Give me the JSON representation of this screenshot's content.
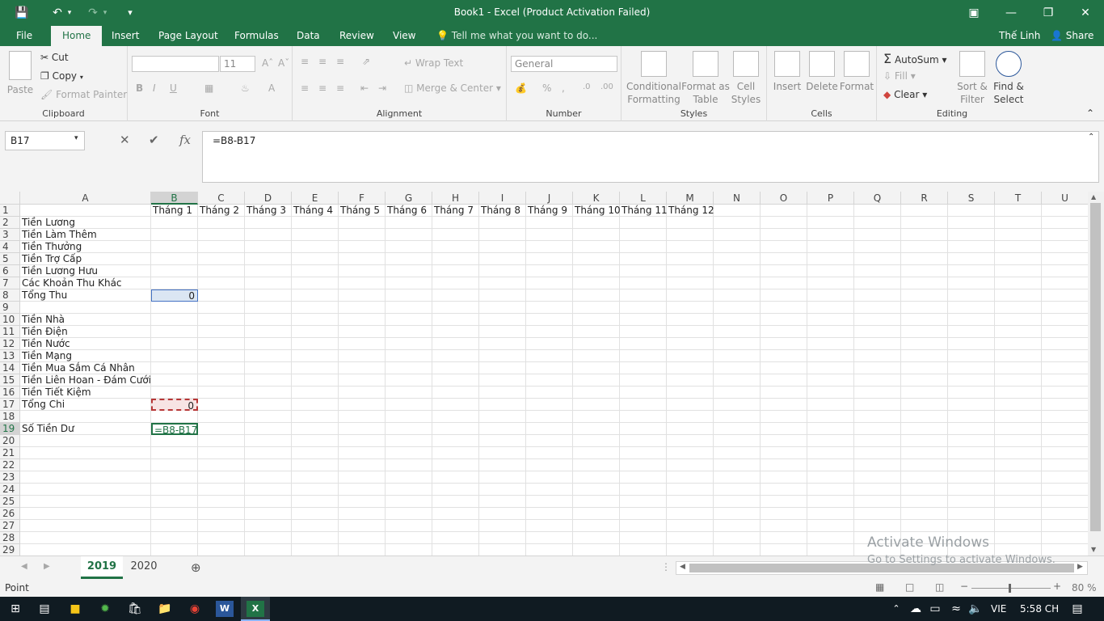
{
  "window": {
    "title": "Book1 - Excel (Product Activation Failed)",
    "user": "Thế Linh",
    "share": "Share"
  },
  "tabs": [
    "File",
    "Home",
    "Insert",
    "Page Layout",
    "Formulas",
    "Data",
    "Review",
    "View"
  ],
  "tellme": "Tell me what you want to do...",
  "ribbon": {
    "clipboard": {
      "paste": "Paste",
      "cut": "Cut",
      "copy": "Copy",
      "format_painter": "Format Painter",
      "label": "Clipboard"
    },
    "font": {
      "size": "11",
      "bold": "B",
      "italic": "I",
      "underline": "U",
      "label": "Font"
    },
    "alignment": {
      "wrap": "Wrap Text",
      "merge": "Merge & Center",
      "label": "Alignment"
    },
    "number": {
      "format": "General",
      "percent": "%",
      "comma": ",",
      "label": "Number"
    },
    "styles": {
      "conditional": "Conditional Formatting",
      "format_table": "Format as Table",
      "cell_styles": "Cell Styles",
      "label": "Styles"
    },
    "cells": {
      "insert": "Insert",
      "delete": "Delete",
      "format": "Format",
      "label": "Cells"
    },
    "editing": {
      "autosum": "AutoSum",
      "fill": "Fill",
      "clear": "Clear",
      "sort": "Sort & Filter",
      "find": "Find & Select",
      "label": "Editing"
    }
  },
  "formula_bar": {
    "name_box": "B17",
    "formula": "=B8-B17"
  },
  "columns": [
    "A",
    "B",
    "C",
    "D",
    "E",
    "F",
    "G",
    "H",
    "I",
    "J",
    "K",
    "L",
    "M",
    "N",
    "O",
    "P",
    "Q",
    "R",
    "S",
    "T",
    "U"
  ],
  "months": [
    "Tháng 1",
    "Tháng 2",
    "Tháng 3",
    "Tháng 4",
    "Tháng 5",
    "Tháng 6",
    "Tháng 7",
    "Tháng 8",
    "Tháng 9",
    "Tháng 10",
    "Tháng 11",
    "Tháng 12"
  ],
  "rows": [
    "1",
    "2",
    "3",
    "4",
    "5",
    "6",
    "7",
    "8",
    "9",
    "10",
    "11",
    "12",
    "13",
    "14",
    "15",
    "16",
    "17",
    "18",
    "19",
    "20",
    "21",
    "22",
    "23",
    "24",
    "25",
    "26",
    "27",
    "28",
    "29"
  ],
  "labels": {
    "r2": "Tiền Lương",
    "r3": "Tiền Làm Thêm",
    "r4": "Tiền Thưởng",
    "r5": "Tiền Trợ Cấp",
    "r6": "Tiền Lương Hưu",
    "r7": "Các Khoản Thu Khác",
    "r8": "Tổng Thu",
    "r10": "Tiền Nhà",
    "r11": "Tiền Điện",
    "r12": "Tiền Nước",
    "r13": "Tiền Mạng",
    "r14": "Tiền Mua Sắm Cá Nhân",
    "r15": "Tiền Liên Hoan - Đám Cưới",
    "r16": "Tiền Tiết Kiệm",
    "r17": "Tổng Chi",
    "r19": "Số Tiền Dư"
  },
  "values": {
    "b8": "0",
    "b17": "0",
    "b19": "=B8-B17"
  },
  "sheets": [
    "2019",
    "2020"
  ],
  "status": {
    "mode": "Point",
    "zoom": "80 %"
  },
  "watermark": {
    "line1": "Activate Windows",
    "line2": "Go to Settings to activate Windows."
  },
  "taskbar": {
    "lang": "VIE",
    "time": "5:58 CH"
  }
}
